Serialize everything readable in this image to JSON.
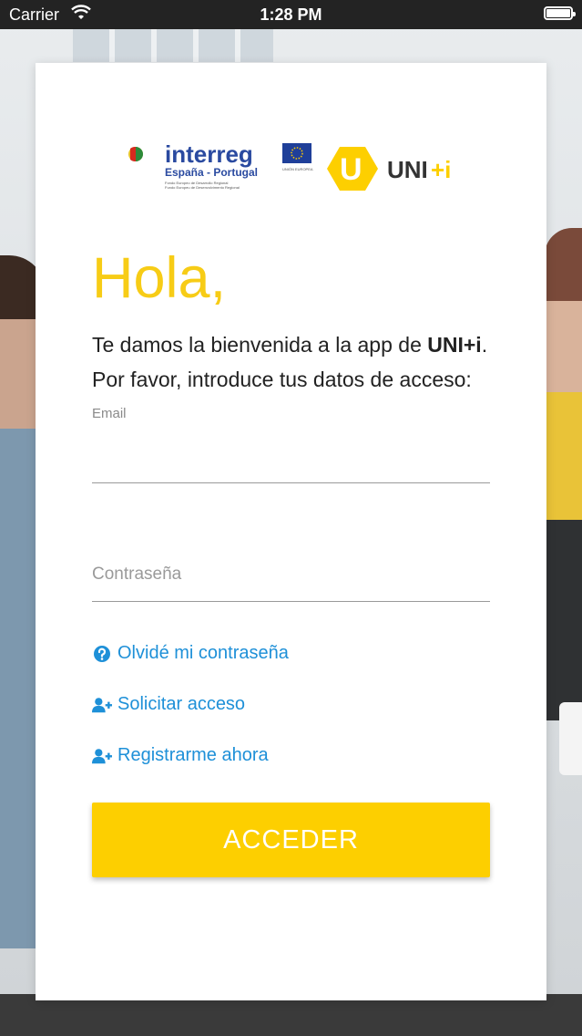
{
  "status_bar": {
    "carrier": "Carrier",
    "time": "1:28 PM"
  },
  "logos": {
    "interreg_title": "interreg",
    "interreg_subtitle": "España - Portugal",
    "interreg_fine1": "Fondo Europeo de Desarrollo Regional",
    "interreg_fine2": "Fundo Europeu de Desenvolvimento Regional",
    "eu_caption": "UNIÓN EUROPEA",
    "unii_badge": "U",
    "unii_name": "UNI",
    "unii_plus": "+i"
  },
  "greeting": "Hola,",
  "welcome": {
    "line1_prefix": "Te damos la bienvenida a la app de ",
    "line1_brand": "UNI+i",
    "line1_suffix": ".",
    "line2": "Por favor, introduce tus datos de acceso:"
  },
  "form": {
    "email_label": "Email",
    "email_value": "",
    "password_placeholder": "Contraseña"
  },
  "links": {
    "forgot": "Olvidé mi contraseña",
    "request": "Solicitar acceso",
    "register": "Registrarme ahora"
  },
  "submit_label": "ACCEDER",
  "colors": {
    "accent_yellow": "#fdcf00",
    "greeting_yellow": "#f7cc16",
    "link_blue": "#1e90d8"
  }
}
